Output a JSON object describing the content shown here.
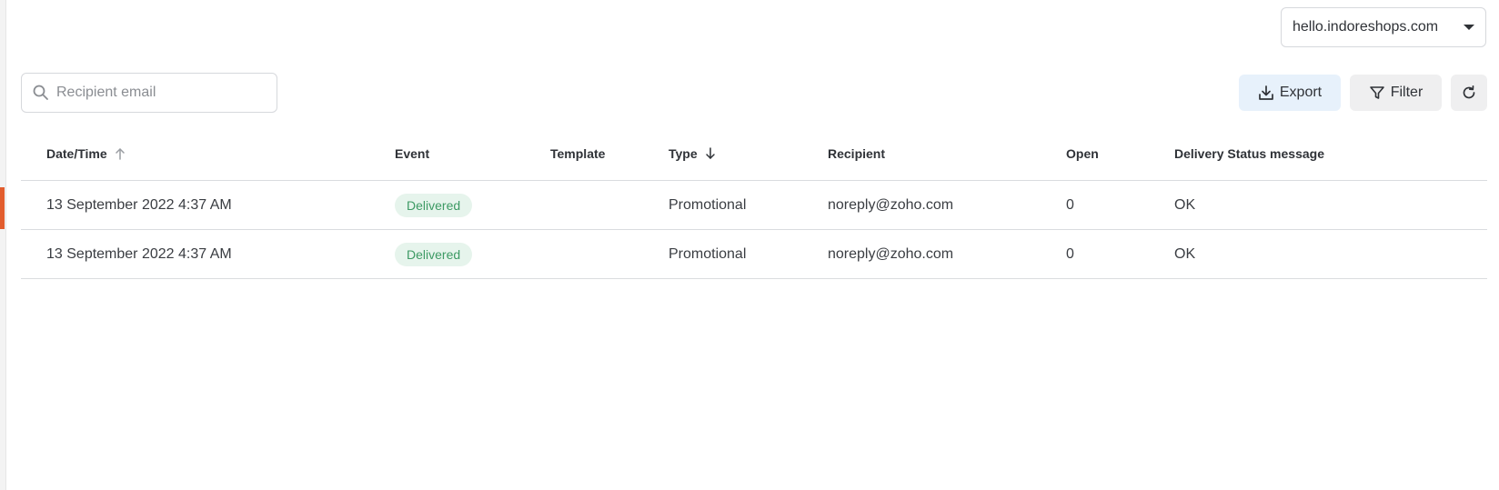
{
  "domain_select": {
    "value": "hello.indoreshops.com",
    "icon": "caret-down-icon"
  },
  "search": {
    "placeholder": "Recipient email",
    "value": "",
    "icon": "search-icon"
  },
  "toolbar": {
    "export_label": "Export",
    "filter_label": "Filter",
    "refresh_icon": "refresh-icon"
  },
  "colors": {
    "accent": "#e25d2e",
    "badge_bg": "#e6f4ec",
    "badge_text": "#3d9a64",
    "export_bg": "#e7f1fb",
    "button_bg": "#efeff0"
  },
  "table": {
    "columns": {
      "date": "Date/Time",
      "event": "Event",
      "template": "Template",
      "type": "Type",
      "recipient": "Recipient",
      "open": "Open",
      "status": "Delivery Status message"
    },
    "sort": {
      "date": "ascending",
      "type": "descending"
    },
    "rows": [
      {
        "date": "13 September 2022 4:37 AM",
        "event": "Delivered",
        "template": "",
        "type": "Promotional",
        "recipient": "noreply@zoho.com",
        "open": "0",
        "status": "OK"
      },
      {
        "date": "13 September 2022 4:37 AM",
        "event": "Delivered",
        "template": "",
        "type": "Promotional",
        "recipient": "noreply@zoho.com",
        "open": "0",
        "status": "OK"
      }
    ]
  }
}
